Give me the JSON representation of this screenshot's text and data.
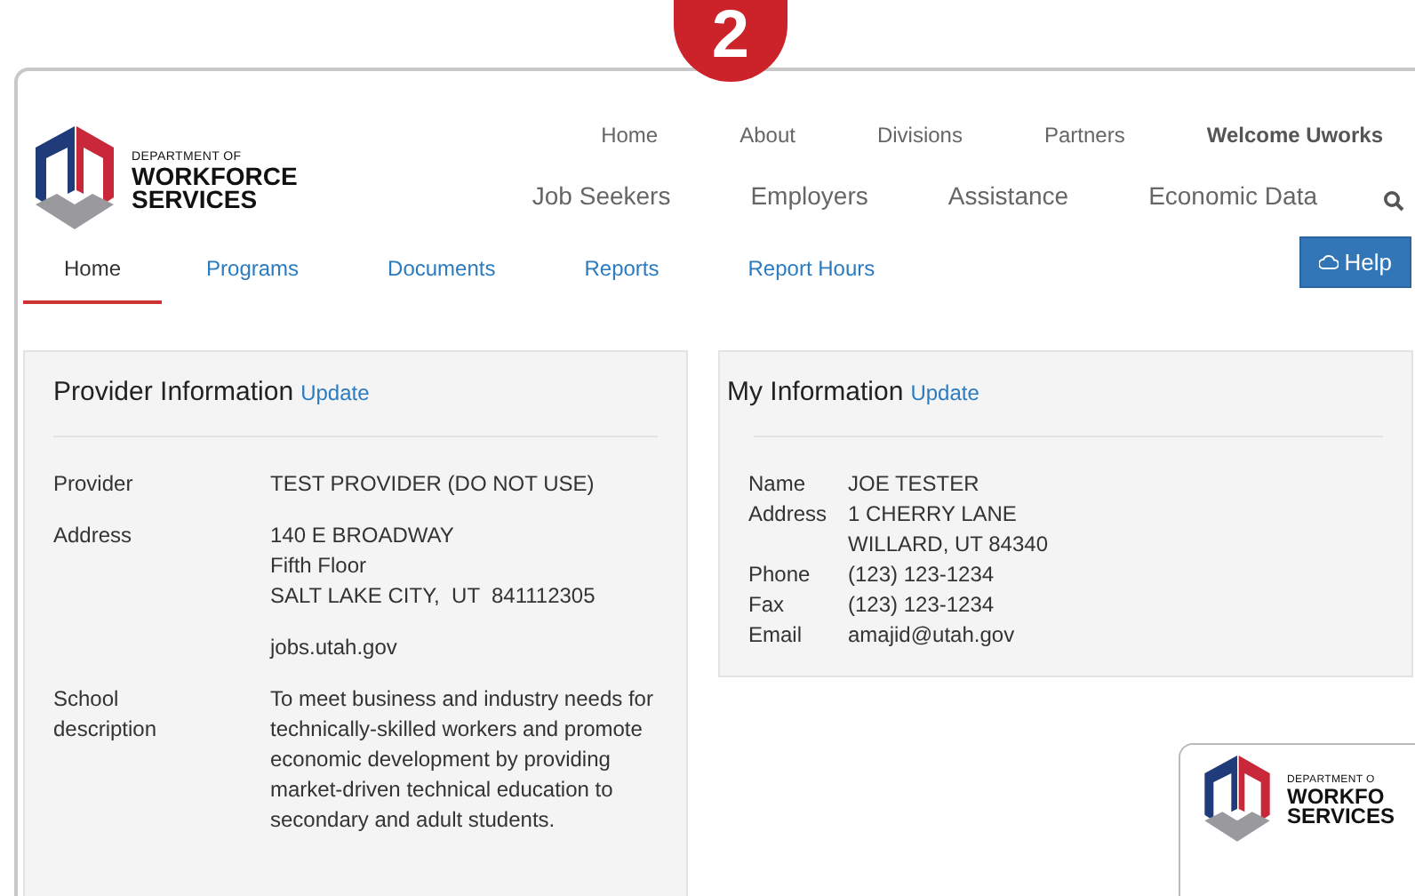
{
  "badge": {
    "text": "2"
  },
  "logo": {
    "lines": [
      "DEPARTMENT OF",
      "WORKFORCE",
      "SERVICES"
    ]
  },
  "top_nav": [
    {
      "label": "Home",
      "kind": "link"
    },
    {
      "label": "About",
      "kind": "link"
    },
    {
      "label": "Divisions",
      "kind": "link"
    },
    {
      "label": "Partners",
      "kind": "link"
    },
    {
      "label": "Welcome Uworks",
      "kind": "greeting"
    }
  ],
  "main_nav": [
    {
      "label": "Job Seekers"
    },
    {
      "label": "Employers"
    },
    {
      "label": "Assistance"
    },
    {
      "label": "Economic Data"
    }
  ],
  "tabs": [
    {
      "label": "Home",
      "selected": true
    },
    {
      "label": "Programs",
      "selected": false
    },
    {
      "label": "Documents",
      "selected": false
    },
    {
      "label": "Reports",
      "selected": false
    },
    {
      "label": "Report Hours",
      "selected": false
    }
  ],
  "help_button": {
    "label": "Help"
  },
  "provider_panel": {
    "title": "Provider Information",
    "update_link": "Update",
    "fields": [
      {
        "label": "Provider",
        "lines": [
          "TEST PROVIDER (DO NOT USE)"
        ]
      },
      {
        "label": "Address",
        "lines": [
          "140 E BROADWAY",
          "Fifth Floor",
          "SALT LAKE CITY,  UT  841112305"
        ]
      },
      {
        "lines": [
          "jobs.utah.gov"
        ]
      },
      {
        "label": "School description",
        "paragraph": "To meet business and industry needs for technically-skilled workers and promote economic development by providing market-driven technical education to secondary and adult students."
      }
    ]
  },
  "my_panel": {
    "title": "My Information",
    "update_link": "Update",
    "fields": [
      {
        "label": "Name",
        "lines": [
          "JOE TESTER"
        ]
      },
      {
        "label": "Address",
        "lines": [
          "1 CHERRY LANE",
          "WILLARD, UT 84340"
        ]
      },
      {
        "label": "Phone",
        "lines": [
          "(123) 123-1234"
        ]
      },
      {
        "label": "Fax",
        "lines": [
          "(123) 123-1234"
        ]
      },
      {
        "label": "Email",
        "lines": [
          "amajid@utah.gov"
        ]
      }
    ]
  },
  "preview_window": {
    "logo_lines": [
      "DEPARTMENT O",
      "WORKFO",
      "SERVICES"
    ]
  }
}
